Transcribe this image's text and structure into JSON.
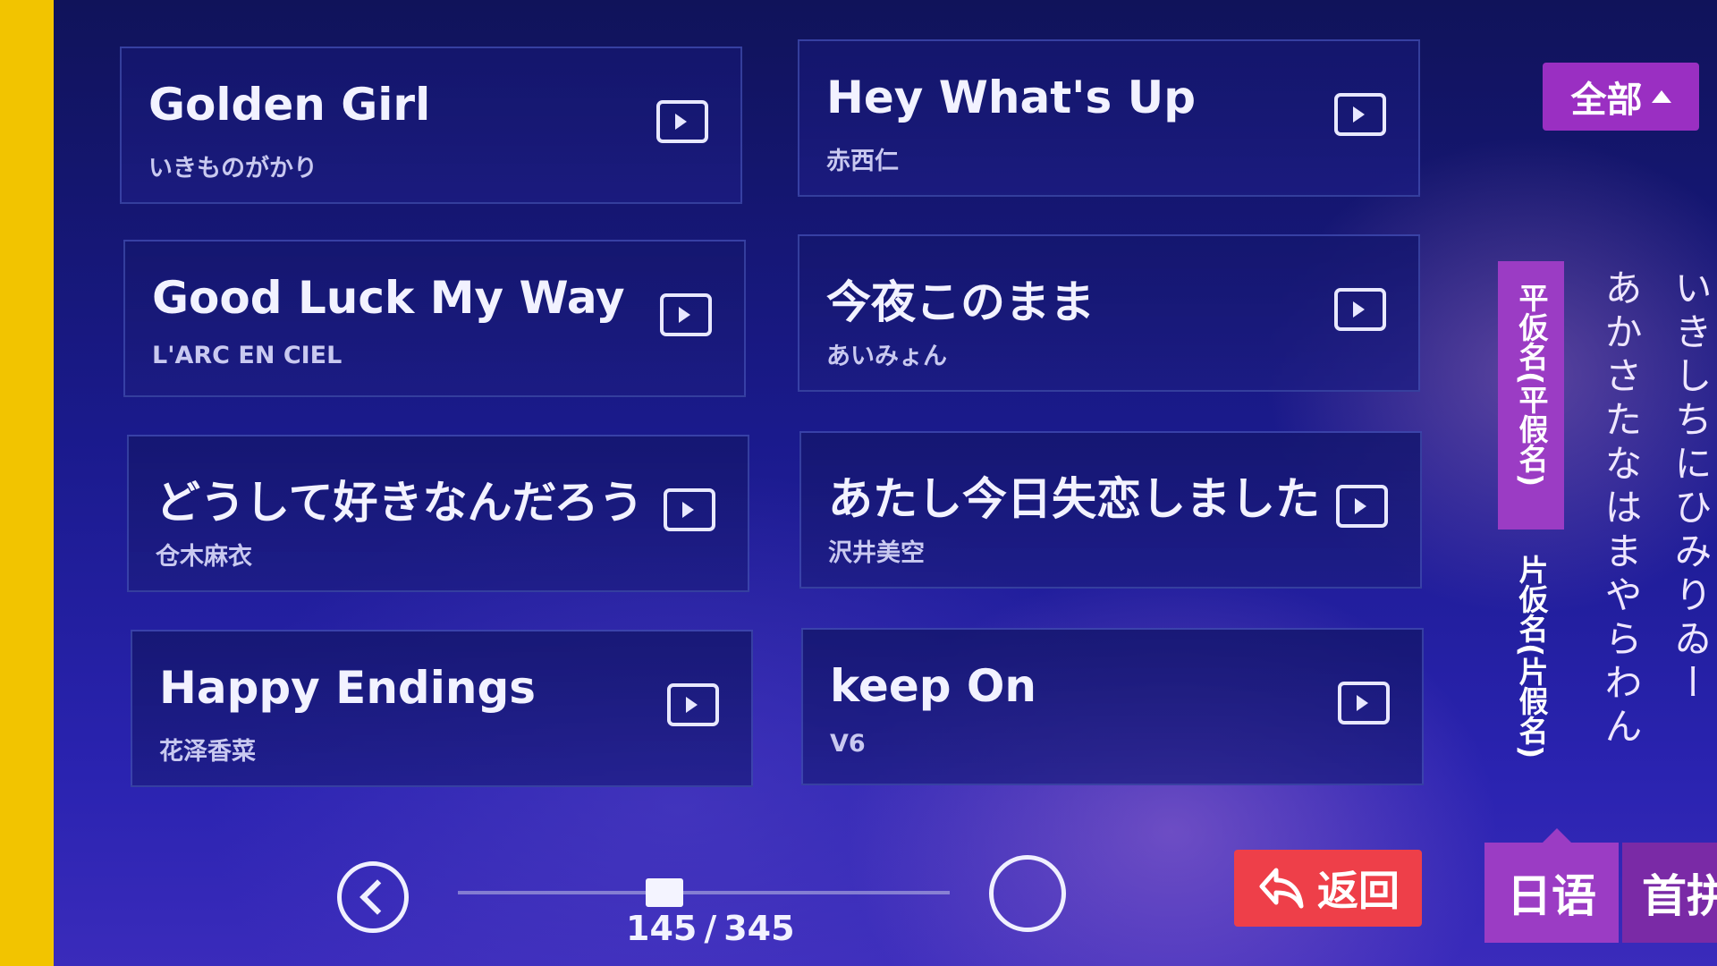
{
  "songs": [
    {
      "title": "Golden Girl",
      "artist": "いきものがかり"
    },
    {
      "title": "Hey What's Up",
      "artist": "赤西仁"
    },
    {
      "title": "Good Luck My Way",
      "artist": "L'ARC EN CIEL"
    },
    {
      "title": "今夜このまま",
      "artist": "あいみょん"
    },
    {
      "title": "どうして好きなんだろう",
      "artist": "仓木麻衣"
    },
    {
      "title": "あたし今日失恋しました",
      "artist": "沢井美空"
    },
    {
      "title": "Happy Endings",
      "artist": "花泽香菜"
    },
    {
      "title": "keep On",
      "artist": "V6"
    }
  ],
  "filter": {
    "all_label": "全部"
  },
  "index_tabs": {
    "hiragana": "平仮名(平假名)",
    "katakana": "片仮名(片假名)"
  },
  "kana_columns": [
    "いきしちにひみりゐー",
    "あかさたなはまやらわん"
  ],
  "pagination": {
    "current": "145",
    "total": "345",
    "progress": 0.42
  },
  "buttons": {
    "return_label": "返回"
  },
  "bottom_tabs": {
    "language": "日语",
    "first": "首拼"
  },
  "colors": {
    "accent_purple": "#9b3cc4",
    "return_red": "#ee3f49",
    "background": "#1a1a8c"
  }
}
